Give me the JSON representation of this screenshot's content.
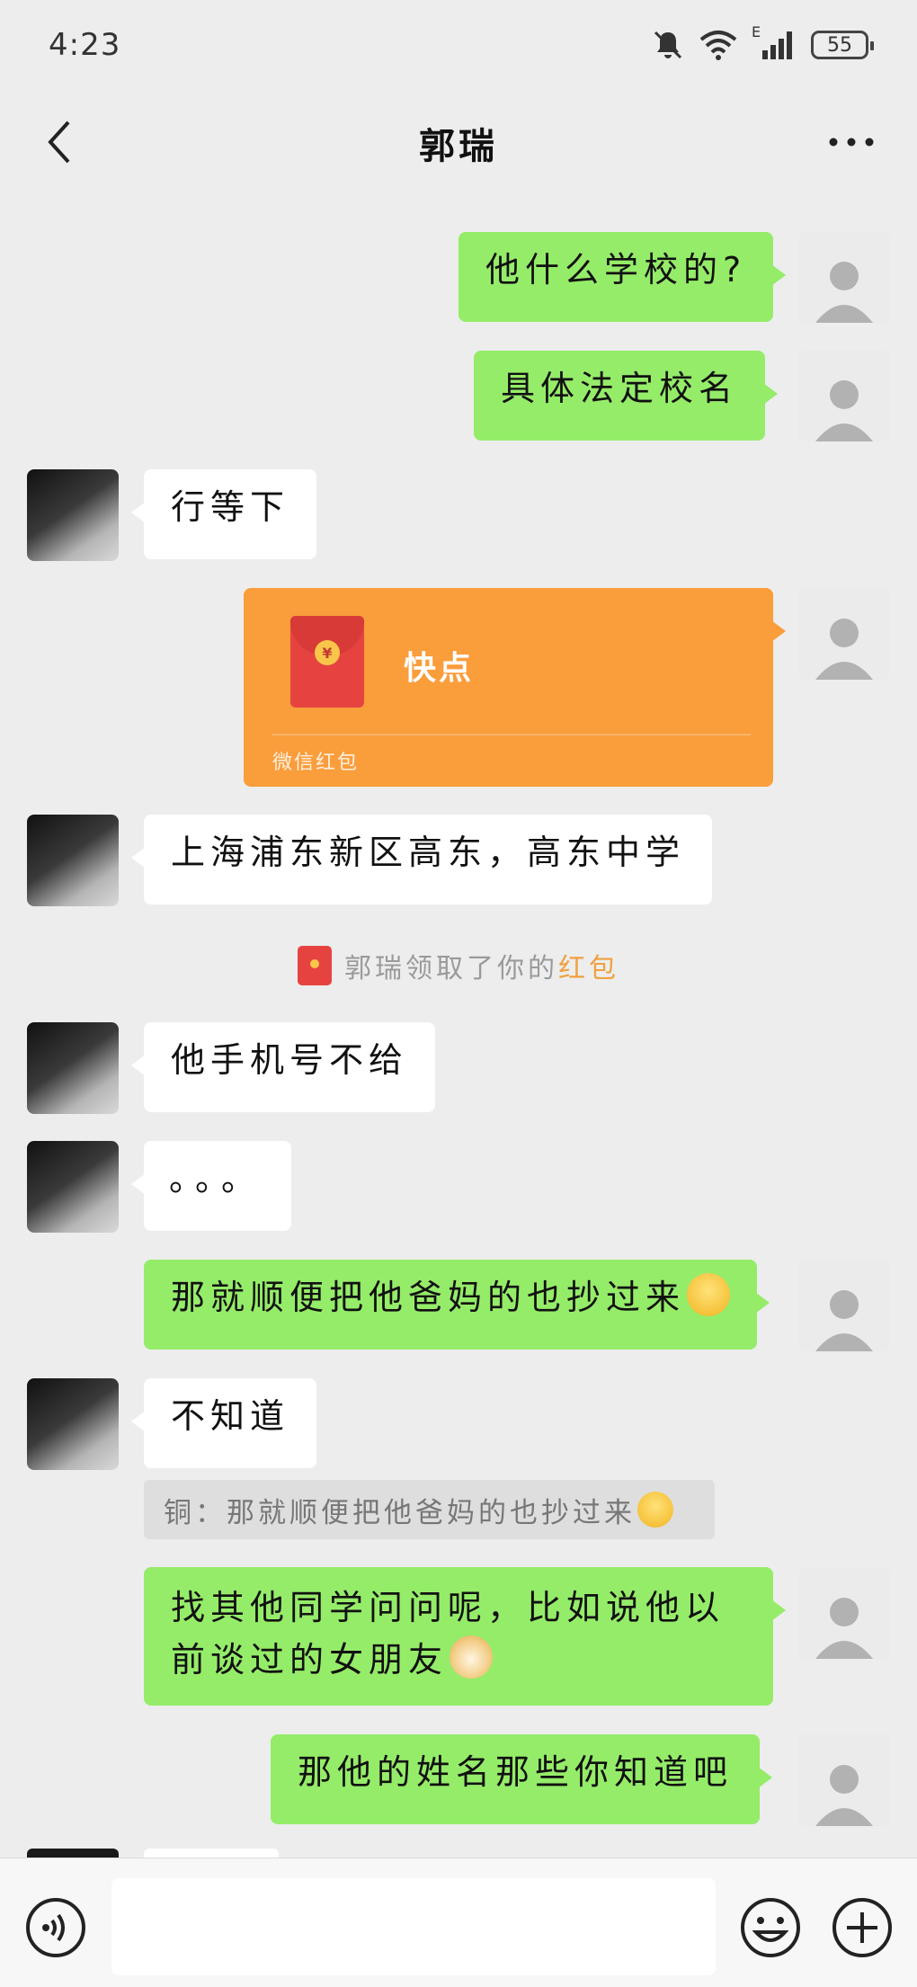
{
  "status": {
    "time": "4:23",
    "network": "E",
    "battery": "55"
  },
  "header": {
    "title": "郭瑞"
  },
  "messages": [
    {
      "side": "right",
      "text": "他什么学校的?"
    },
    {
      "side": "right",
      "text": "具体法定校名"
    },
    {
      "side": "left",
      "text": "行等下"
    },
    {
      "side": "right",
      "type": "red_packet",
      "text": "快点",
      "label": "微信红包"
    },
    {
      "side": "left",
      "text": "上海浦东新区高东，高东中学"
    },
    {
      "side": "left",
      "text": "他手机号不给"
    },
    {
      "side": "left",
      "text": "。。。"
    },
    {
      "side": "right",
      "text": "那就顺便把他爸妈的也抄过来",
      "emoji": "grinning-emoji"
    },
    {
      "side": "left",
      "text": "不知道"
    },
    {
      "side": "right",
      "line1": "找其他同学问问呢，比如说他以",
      "line2": "前谈过的女朋友",
      "emoji": "doge-emoji"
    },
    {
      "side": "right",
      "text": "那他的姓名那些你知道吧"
    }
  ],
  "system": {
    "prefix": "郭瑞领取了你的",
    "highlight": "红包",
    "highlight_color": "#f0a040"
  },
  "quote": {
    "text": "铜：那就顺便把他爸妈的也抄过来",
    "emoji": "grinning-emoji"
  },
  "colors": {
    "sent_bubble": "#95ec69",
    "received_bubble": "#ffffff",
    "background": "#ededed",
    "red_packet": "#fa9d3b"
  },
  "icons": {
    "back": "back-arrow-icon",
    "more": "more-icon",
    "voice": "voice-icon",
    "emoji_button": "emoji-icon",
    "plus": "plus-icon"
  }
}
